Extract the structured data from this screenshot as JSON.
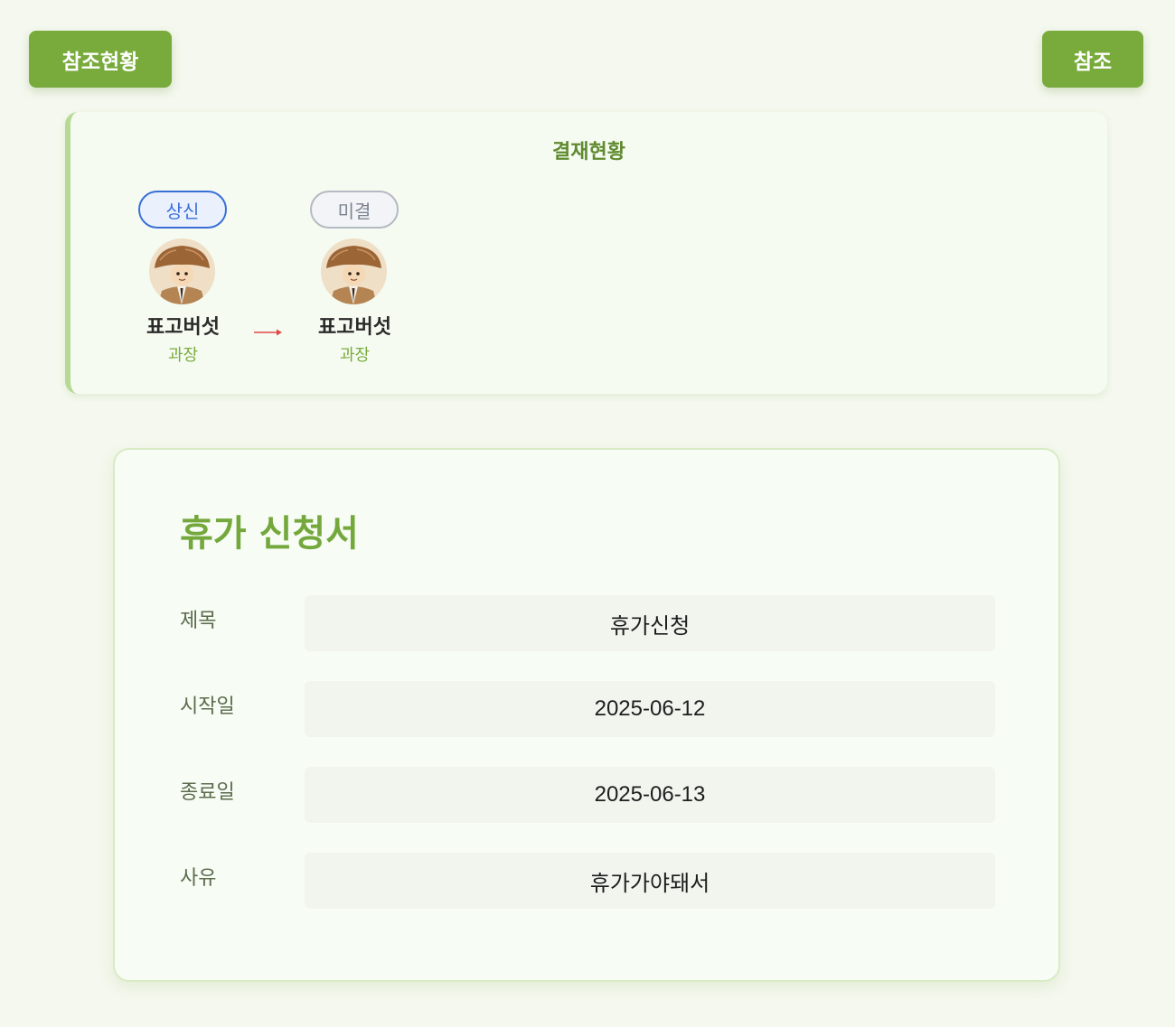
{
  "top_buttons": {
    "reference_status": "참조현황",
    "reference": "참조"
  },
  "approval": {
    "title": "결재현황",
    "approvers": [
      {
        "status": "상신",
        "name": "표고버섯",
        "rank": "과장"
      },
      {
        "status": "미결",
        "name": "표고버섯",
        "rank": "과장"
      }
    ],
    "arrow_icon": "right-arrow-icon"
  },
  "document": {
    "title": "휴가 신청서",
    "fields": [
      {
        "label": "제목",
        "value": "휴가신청"
      },
      {
        "label": "시작일",
        "value": "2025-06-12"
      },
      {
        "label": "종료일",
        "value": "2025-06-13"
      },
      {
        "label": "사유",
        "value": "휴가가야돼서"
      }
    ]
  },
  "colors": {
    "background": "#f4f8ee",
    "accent_green": "#78ab3c",
    "submitted_blue": "#3a6fd8",
    "pending_gray": "#7b8390",
    "arrow_red": "#e04848"
  }
}
